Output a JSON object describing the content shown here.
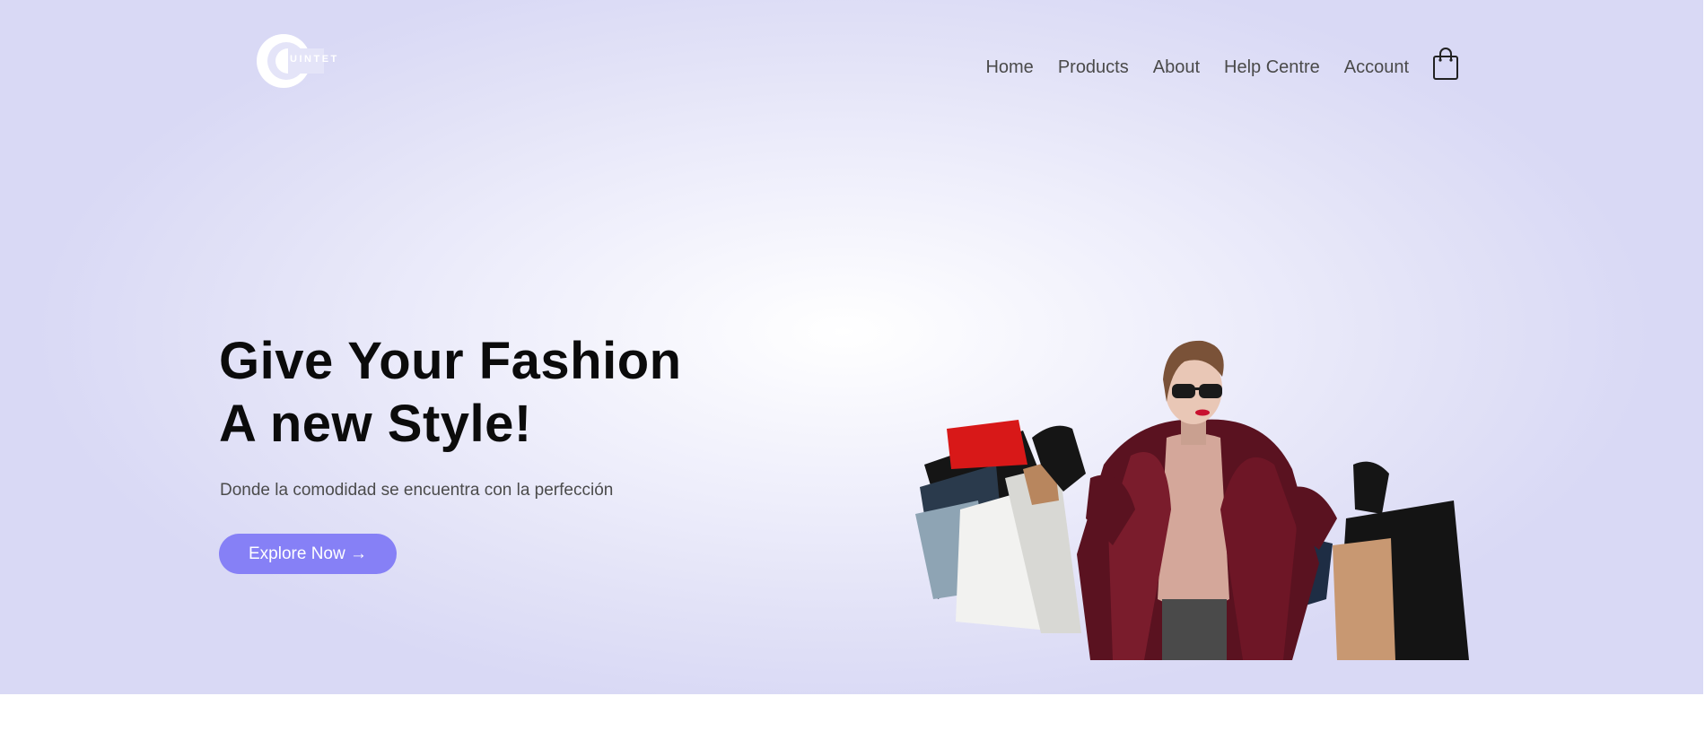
{
  "brand": {
    "logo_text": "QUINTET"
  },
  "nav": {
    "items": [
      {
        "label": "Home"
      },
      {
        "label": "Products"
      },
      {
        "label": "About"
      },
      {
        "label": "Help Centre"
      },
      {
        "label": "Account"
      }
    ],
    "cart_icon": "shopping-bag-icon"
  },
  "hero": {
    "title_line1": "Give Your Fashion",
    "title_line2": "A new Style!",
    "subtitle": "Donde la comodidad se encuentra con la perfección",
    "cta_label": "Explore Now →",
    "image_alt": "Woman in burgundy coat and sunglasses holding shopping bags"
  },
  "colors": {
    "accent": "#8680f6",
    "hero_bg": "#e2e2f7",
    "text_dark": "#0b0b0b",
    "nav_text": "#4a4a4a"
  }
}
